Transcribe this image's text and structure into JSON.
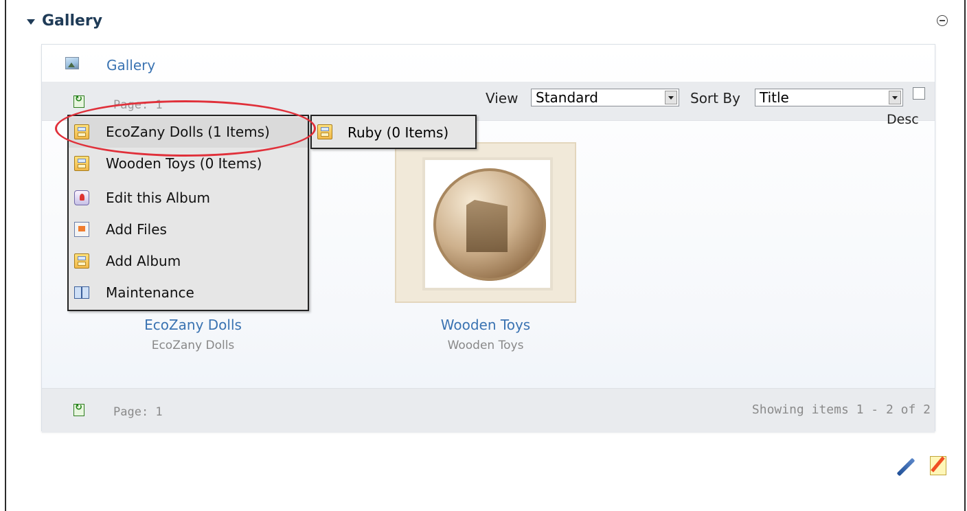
{
  "module": {
    "title": "Gallery"
  },
  "breadcrumb": {
    "link": "Gallery"
  },
  "toolbar": {
    "page_text": "Page: 1",
    "view_label": "View",
    "view_value": "Standard",
    "sort_label": "Sort By",
    "sort_value": "Title",
    "desc_label": "Desc"
  },
  "albums": [
    {
      "title": "EcoZany Dolls",
      "subtitle": "EcoZany Dolls"
    },
    {
      "title": "Wooden Toys",
      "subtitle": "Wooden Toys"
    }
  ],
  "context_menu": {
    "items": [
      {
        "label": "EcoZany Dolls (1 Items)",
        "icon": "album-icon"
      },
      {
        "label": "Wooden Toys (0 Items)",
        "icon": "album-icon"
      },
      {
        "label": "Edit this Album",
        "icon": "edit-album-icon"
      },
      {
        "label": "Add Files",
        "icon": "add-files-icon"
      },
      {
        "label": "Add Album",
        "icon": "album-icon"
      },
      {
        "label": "Maintenance",
        "icon": "book-icon"
      }
    ],
    "submenu": [
      {
        "label": "Ruby (0 Items)",
        "icon": "album-icon"
      }
    ]
  },
  "footer": {
    "page_text": "Page: 1",
    "showing_text": "Showing items 1 - 2 of 2"
  },
  "colors": {
    "link": "#3a73b2",
    "highlight_ring": "#e0303a",
    "title": "#1f3b57"
  }
}
